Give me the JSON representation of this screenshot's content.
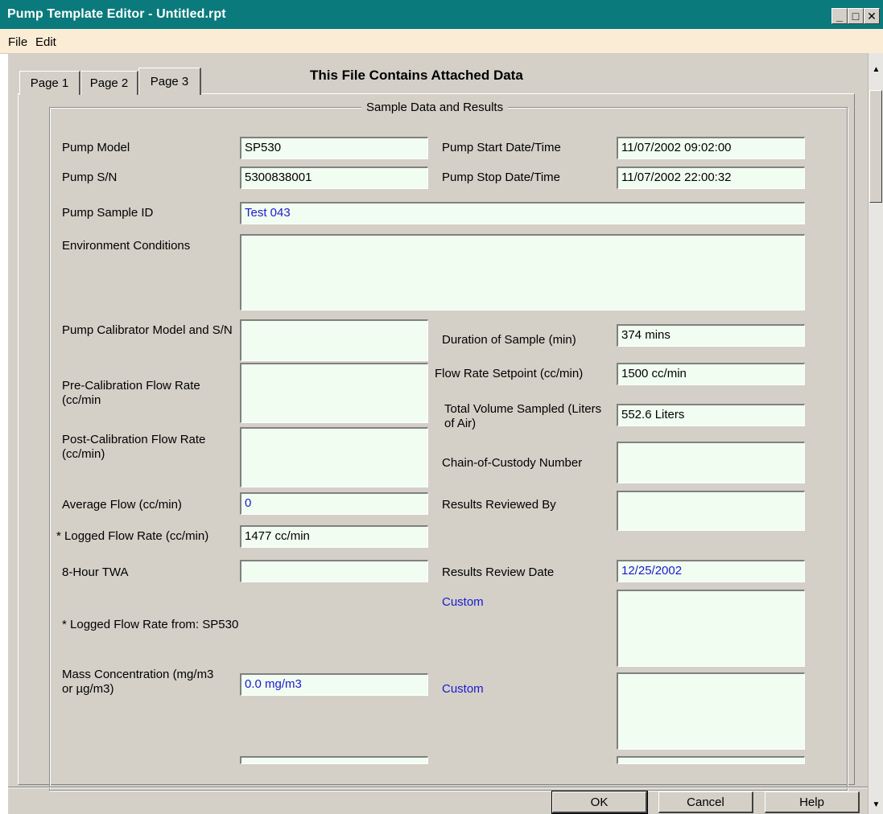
{
  "window": {
    "title": "Pump Template Editor - Untitled.rpt",
    "minimize": "_",
    "maximize": "□",
    "close": "✕"
  },
  "menu": {
    "file": "File",
    "edit": "Edit"
  },
  "tabs": [
    {
      "label": "Page 1"
    },
    {
      "label": "Page 2"
    },
    {
      "label": "Page 3",
      "active": true
    }
  ],
  "banner": "This File Contains Attached Data",
  "group_title": "Sample Data and Results",
  "fields": {
    "pump_model": {
      "label": "Pump Model",
      "value": "SP530"
    },
    "pump_sn": {
      "label": "Pump S/N",
      "value": "5300838001"
    },
    "pump_start": {
      "label": "Pump Start Date/Time",
      "value": "11/07/2002 09:02:00"
    },
    "pump_stop": {
      "label": "Pump Stop Date/Time",
      "value": "11/07/2002 22:00:32"
    },
    "sample_id": {
      "label": "Pump Sample ID",
      "value": "Test 043"
    },
    "environment": {
      "label": "Environment Conditions",
      "value": ""
    },
    "calibrator": {
      "label": "Pump Calibrator Model and S/N",
      "value": ""
    },
    "duration": {
      "label": "Duration of Sample (min)",
      "value": "374 mins"
    },
    "pre_cal": {
      "label": "Pre-Calibration Flow Rate (cc/min",
      "value": ""
    },
    "setpoint": {
      "label": "Flow Rate Setpoint (cc/min)",
      "value": "1500 cc/min"
    },
    "total_volume": {
      "label": "Total Volume Sampled (Liters of Air)",
      "value": "552.6 Liters"
    },
    "post_cal": {
      "label": "Post-Calibration Flow Rate (cc/min)",
      "value": ""
    },
    "chain_custody": {
      "label": "Chain-of-Custody Number",
      "value": ""
    },
    "avg_flow": {
      "label": "Average Flow (cc/min)",
      "value": "0"
    },
    "reviewed_by": {
      "label": "Results Reviewed By",
      "value": ""
    },
    "logged_flow": {
      "label": "* Logged Flow Rate (cc/min)",
      "value": "1477 cc/min"
    },
    "twa": {
      "label": "8-Hour TWA",
      "value": ""
    },
    "review_date": {
      "label": "Results Review Date",
      "value": "12/25/2002"
    },
    "custom1": {
      "label": "Custom",
      "value": ""
    },
    "logged_note": "* Logged Flow Rate from: SP530",
    "mass_conc": {
      "label": "Mass Concentration (mg/m3 or µg/m3)",
      "value": "0.0 mg/m3"
    },
    "custom2": {
      "label": "Custom",
      "value": ""
    }
  },
  "buttons": {
    "ok": "OK",
    "cancel": "Cancel",
    "help": "Help"
  },
  "colors": {
    "titlebar": "#0a7a7c",
    "menubar": "#fbecd6",
    "dialog_face": "#d4d0c8",
    "field_bg": "#f1fdf1",
    "link_blue": "#1a1acf"
  }
}
